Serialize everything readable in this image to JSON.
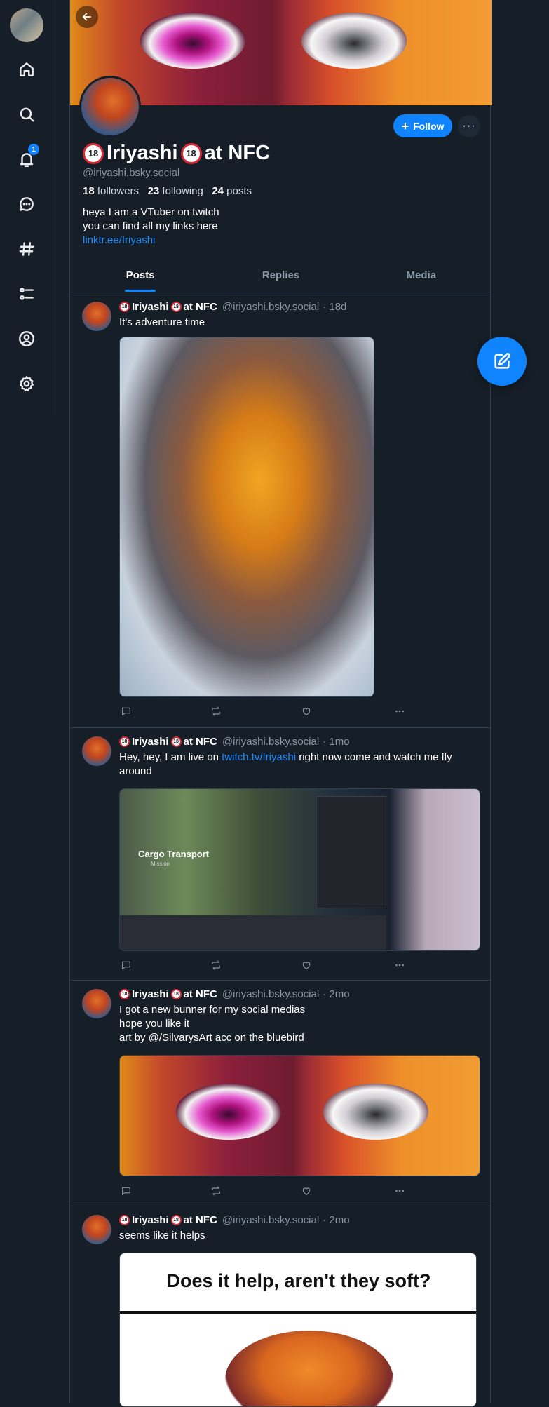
{
  "profile": {
    "name_part1": "Iriyashi",
    "name_part2": "at NFC",
    "rating_badge": "18",
    "handle": "@iriyashi.bsky.social",
    "followers_count": "18",
    "followers_label": "followers",
    "following_count": "23",
    "following_label": "following",
    "posts_count": "24",
    "posts_label": "posts",
    "bio_line1": "heya I am a VTuber on twitch",
    "bio_line2": "you can find all my links here",
    "bio_link": "linktr.ee/Iriyashi",
    "follow_label": "Follow",
    "more_label": "···"
  },
  "nav": {
    "notification_count": "1",
    "icons": [
      "home-icon",
      "search-icon",
      "bell-icon",
      "chat-icon",
      "hash-icon",
      "list-icon",
      "profile-icon",
      "settings-icon"
    ]
  },
  "tabs": [
    {
      "label": "Posts",
      "active": true
    },
    {
      "label": "Replies",
      "active": false
    },
    {
      "label": "Media",
      "active": false
    }
  ],
  "posts": [
    {
      "name_part1": "Iriyashi",
      "name_part2": "at NFC",
      "handle": "@iriyashi.bsky.social",
      "time": "· 18d",
      "text": "It's adventure time"
    },
    {
      "name_part1": "Iriyashi",
      "name_part2": "at NFC",
      "handle": "@iriyashi.bsky.social",
      "time": "· 1mo",
      "text_pre": "Hey, hey, I am live on ",
      "text_link": "twitch.tv/Iriyashi",
      "text_post": "  right now come and watch me fly around",
      "media_caption": "Cargo Transport",
      "media_subcaption": "Mission"
    },
    {
      "name_part1": "Iriyashi",
      "name_part2": "at NFC",
      "handle": "@iriyashi.bsky.social",
      "time": "· 2mo",
      "line1": "I got a new bunner for my social medias",
      "line2": "hope you like it",
      "line3": "art by @/SilvarysArt acc on the bluebird"
    },
    {
      "name_part1": "Iriyashi",
      "name_part2": "at NFC",
      "handle": "@iriyashi.bsky.social",
      "time": "· 2mo",
      "text": "seems like it helps",
      "image_text": "Does it help, aren't they soft?"
    }
  ],
  "colors": {
    "background": "#161e27",
    "accent": "#1083fe",
    "link": "#208bfe",
    "muted": "#8b98a5",
    "border": "#2e4052"
  }
}
